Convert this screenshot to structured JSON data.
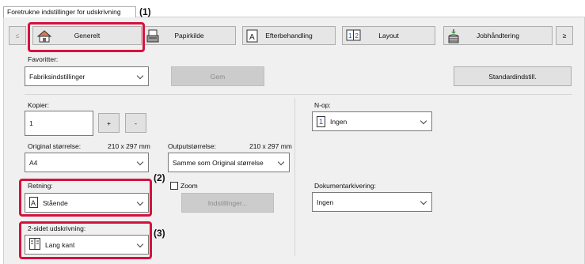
{
  "tab_title": "Foretrukne indstillinger for udskrivning",
  "callouts": {
    "c1": "(1)",
    "c2": "(2)",
    "c3": "(3)"
  },
  "categories": {
    "scroll_left": "≤",
    "general": "Generelt",
    "paper_source": "Papirkilde",
    "finishing": "Efterbehandling",
    "layout": "Layout",
    "job_handling": "Jobhåndtering",
    "scroll_right": "≥"
  },
  "favorites": {
    "label": "Favoritter:",
    "value": "Fabriksindstillinger",
    "save": "Gem",
    "defaults": "Standardindstill."
  },
  "copies": {
    "label": "Kopier:",
    "value": "1",
    "plus": "+",
    "minus": "-"
  },
  "original_size": {
    "label": "Original størrelse:",
    "dims": "210 x 297 mm",
    "value": "A4"
  },
  "output_size": {
    "label": "Outputstørrelse:",
    "dims": "210 x 297 mm",
    "value": "Samme som Original størrelse"
  },
  "orientation": {
    "label": "Retning:",
    "value": "Stående"
  },
  "zoom": {
    "label": "Zoom",
    "settings": "Indstillinger..."
  },
  "duplex": {
    "label": "2-sidet udskrivning:",
    "value": "Lang kant"
  },
  "nup": {
    "label": "N-op:",
    "value": "Ingen",
    "icon_digit": "1"
  },
  "doc_filing": {
    "label": "Dokumentarkivering:",
    "value": "Ingen"
  },
  "colors": {
    "highlight": "#d4123e"
  }
}
